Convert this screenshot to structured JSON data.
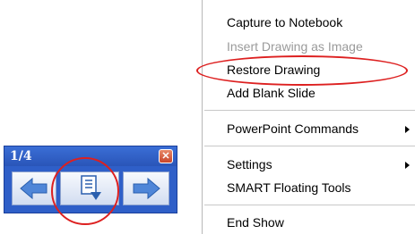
{
  "toolbar": {
    "page_indicator": "1/4",
    "close_glyph": "✕",
    "prev_icon": "left-arrow-icon",
    "menu_icon": "page-menu-icon",
    "next_icon": "right-arrow-icon"
  },
  "menu": {
    "items": [
      {
        "label": "Capture to Notebook",
        "disabled": false,
        "submenu": false
      },
      {
        "label": "Insert Drawing as Image",
        "disabled": true,
        "submenu": false
      },
      {
        "label": "Restore Drawing",
        "disabled": false,
        "submenu": false
      },
      {
        "label": "Add Blank Slide",
        "disabled": false,
        "submenu": false
      },
      {
        "label": "PowerPoint Commands",
        "disabled": false,
        "submenu": true
      },
      {
        "label": "Settings",
        "disabled": false,
        "submenu": true
      },
      {
        "label": "SMART Floating Tools",
        "disabled": false,
        "submenu": false
      },
      {
        "label": "End Show",
        "disabled": false,
        "submenu": false
      }
    ]
  },
  "colors": {
    "toolbar_blue": "#2f5fc8",
    "annotation_red": "#dd2020",
    "disabled_text": "#9a9a9a"
  }
}
